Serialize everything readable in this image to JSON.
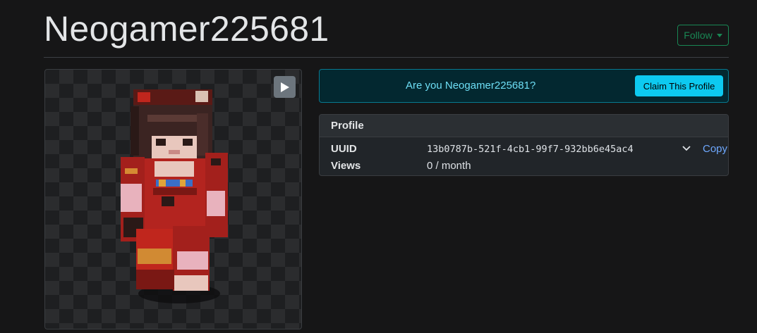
{
  "header": {
    "username": "Neogamer225681",
    "follow_label": "Follow"
  },
  "claim": {
    "question": "Are you Neogamer225681?",
    "button_label": "Claim This Profile"
  },
  "profile": {
    "card_title": "Profile",
    "rows": [
      {
        "label": "UUID",
        "value": "13b0787b-521f-4cb1-99f7-932bb6e45ac4",
        "action": "Copy"
      },
      {
        "label": "Views",
        "value": "0 / month"
      }
    ]
  },
  "icons": {
    "play": "play-icon",
    "chevron": "chevron-down-icon",
    "caret": "caret-down-icon"
  },
  "colors": {
    "background": "#161617",
    "follow": "#198754",
    "info": "#0dcaf0",
    "link": "#6ea8fe"
  }
}
